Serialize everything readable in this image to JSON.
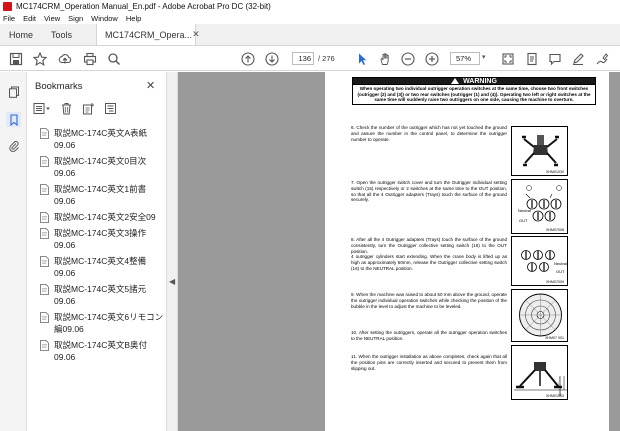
{
  "window": {
    "title": "MC174CRM_Operation Manual_En.pdf - Adobe Acrobat Pro DC (32-bit)"
  },
  "menu": [
    "File",
    "Edit",
    "View",
    "Sign",
    "Window",
    "Help"
  ],
  "tabs": {
    "home": "Home",
    "tools": "Tools",
    "document": "MC174CRM_Opera..."
  },
  "toolbar": {
    "page_current": "136",
    "page_total": "/ 276",
    "zoom": "57%"
  },
  "bookmarks": {
    "title": "Bookmarks",
    "items": [
      "取説MC-174C英文A表紙\n09.06",
      "取説MC-174C英文0目次\n09.06",
      "取説MC-174C英文1前書\n09.06",
      "取説MC-174C英文2安全09",
      "取説MC-174C英文3操作\n09.06",
      "取説MC-174C英文4整備\n09.06",
      "取説MC-174C英文5諸元\n09.06",
      "取説MC-174C英文6リモコン\n編09.06",
      "取説MC-174C英文B奥付\n09.06"
    ]
  },
  "document": {
    "warning_title": "WARNING",
    "warning_text": "When operating two individual outrigger operation switches at the same time, choose two front switches (outrigger (2) and (3)) or two rear switches (outrigger (1) and (4)). Operating two left or right switches at the same time will suddenly raise two outriggers on one side, causing the machine to overturn.",
    "steps": [
      "6. Check the number of the outrigger which has not yet touched the ground and assure the number in the control panel, to determine the outrigger number to operate.",
      "7. Open the outrigger switch cover and turn the Outrigger individual setting switch (15) respectively or 2 switches at the same time to the OUT position, so that all the 4 Outrigger adapters (Trays) touch the surface of the ground securely.",
      "8. After all the 4 Outrigger adapters (Trays) touch the surface of the ground consistently, turn the Outrigger collective setting switch (16) to the OUT position.\n4 outrigger cylinders start extending. When the crane body is lifted up as high as approximately 50mm, release the Outrigger collective setting switch (16) to the NEUTRAL position.",
      "9. When the machine was raised to about 50 mm above the ground, operate the outrigger individual operation switches while checking the position of the bubble in the level to adjust the machine to be leveled.",
      "10. After setting the outriggers, operate all the outrigger operation switches to the NEUTRAL position.",
      "11. When the outrigger installation as above completes, check again that all the position pins are correctly inserted and secured to prevent them from slipping out."
    ],
    "figure_labels": [
      "XHM01030",
      "XHM07008",
      "XHM07009",
      "XHM07 001",
      "XHM01003"
    ],
    "fig_words": {
      "neutral": "Neutral",
      "out": "OUT",
      "about": "About 50mm"
    }
  }
}
